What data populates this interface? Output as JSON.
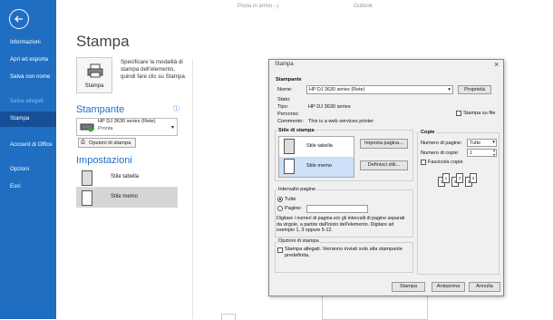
{
  "titlebar": {
    "center": "Posta in arrivo - j",
    "app": "Outlook"
  },
  "sidebar": {
    "items": [
      {
        "label": "Informazioni"
      },
      {
        "label": "Apri ed esporta"
      },
      {
        "label": "Salva con nome"
      },
      {
        "label": "Salva allegati"
      },
      {
        "label": "Stampa"
      },
      {
        "label": "Account di Office"
      },
      {
        "label": "Opzioni"
      },
      {
        "label": "Esci"
      }
    ]
  },
  "backstage": {
    "title": "Stampa",
    "print_button_label": "Stampa",
    "print_description": "Specificare la modalità di stampa dell'elemento, quindi fare clic su Stampa.",
    "printer_heading": "Stampante",
    "printer_name": "HP DJ 3630 series (Rete)",
    "printer_status": "Pronta",
    "print_options_label": "Opzioni di stampa",
    "settings_heading": "Impostazioni",
    "styles": [
      {
        "label": "Stile tabella"
      },
      {
        "label": "Stile memo"
      }
    ]
  },
  "dialog": {
    "title": "Stampa",
    "printer_section": "Stampante",
    "name_label": "Nome:",
    "name_value": "HP DJ 3630 series (Rete)",
    "properties_button": "Proprietà",
    "state_label": "Stato:",
    "type_label": "Tipo:",
    "type_value": "HP DJ 3630 series",
    "path_label": "Percorso:",
    "comment_label": "Commento:",
    "comment_value": "This is a web services printer",
    "print_to_file": "Stampa su file",
    "style_section": "Stile di stampa",
    "styles": [
      {
        "label": "Stile tabella"
      },
      {
        "label": "Stile memo"
      }
    ],
    "page_setup_button": "Imposta pagina...",
    "define_styles_button": "Definisci stili...",
    "copies_section": "Copie",
    "pages_label": "Numero di pagine:",
    "pages_value": "Tutte",
    "copies_label": "Numero di copie:",
    "copies_value": "1",
    "collate_label": "Fascicola copie",
    "range_section": "Intervallo pagine",
    "all_label": "Tutte",
    "pages_radio_label": "Pagine:",
    "range_hint": "Digitare i numeri di pagina e/o gli intervalli di pagine separati da virgole, a partire dall'inizio dell'elemento. Digitare ad esempio 1, 3 oppure 5-12.",
    "options_section": "Opzioni di stampa",
    "attachments_label": "Stampa allegati. Verranno inviati solo alla stampante predefinita.",
    "print_button": "Stampa",
    "preview_button": "Anteprima",
    "cancel_button": "Annulla"
  }
}
